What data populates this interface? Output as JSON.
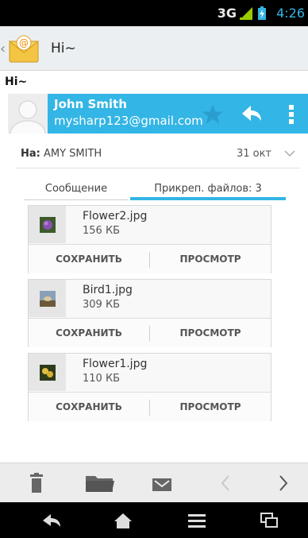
{
  "status": {
    "network": "3G",
    "time": "4:26"
  },
  "app_bar": {
    "title": "Hi~"
  },
  "message": {
    "subject": "Hi~",
    "sender_name": "John Smith",
    "sender_email": "mysharp123@gmail.com",
    "to_label": "На:",
    "to_value": "AMY SMITH",
    "date": "31 окт"
  },
  "tabs": {
    "message": "Сообщение",
    "attachments": "Прикреп. файлов: 3"
  },
  "attachments": [
    {
      "name": "Flower2.jpg",
      "size": "156 КБ",
      "save": "СОХРАНИТЬ",
      "view": "ПРОСМОТР"
    },
    {
      "name": "Bird1.jpg",
      "size": "309 КБ",
      "save": "СОХРАНИТЬ",
      "view": "ПРОСМОТР"
    },
    {
      "name": "Flower1.jpg",
      "size": "110 КБ",
      "save": "СОХРАНИТЬ",
      "view": "ПРОСМОТР"
    }
  ],
  "icons": {
    "app": "email-app-icon",
    "star": "star-icon",
    "reply": "reply-icon",
    "overflow": "overflow-menu-icon",
    "delete": "trash-icon",
    "move": "folder-icon",
    "mark": "envelope-icon",
    "prev": "chevron-left-icon",
    "next": "chevron-right-icon",
    "nav_back": "back-icon",
    "nav_home": "home-icon",
    "nav_menu": "menu-icon",
    "nav_recent": "recent-apps-icon"
  },
  "colors": {
    "accent": "#33b5e5",
    "status_bar": "#000000",
    "action_bar": "#eceff1"
  }
}
